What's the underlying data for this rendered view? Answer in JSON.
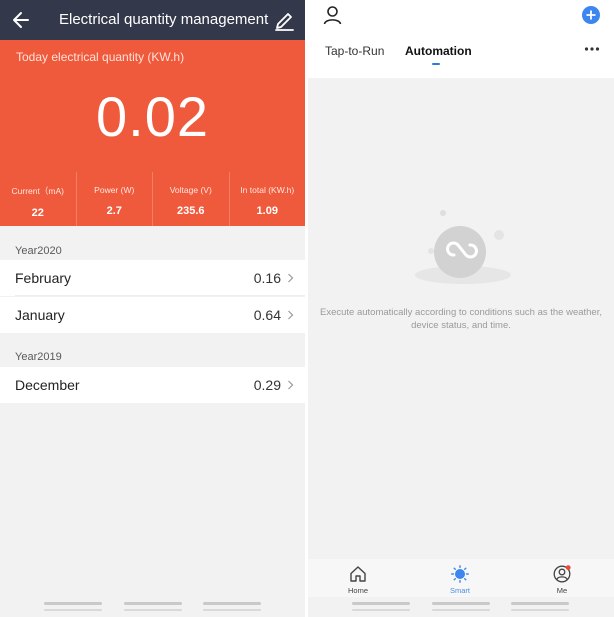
{
  "left": {
    "header": {
      "title": "Electrical quantity management",
      "back_icon": "arrow-left-icon",
      "edit_icon": "pencil-icon"
    },
    "today": {
      "label": "Today electrical quantity (KW.h)",
      "value": "0.02"
    },
    "stats": [
      {
        "label": "Current（mA)",
        "value": "22"
      },
      {
        "label": "Power (W)",
        "value": "2.7"
      },
      {
        "label": "Voltage (V)",
        "value": "235.6"
      },
      {
        "label": "In total (KW.h)",
        "value": "1.09"
      }
    ],
    "years": [
      {
        "year": "Year2020",
        "months": [
          {
            "month": "February",
            "value": "0.16"
          },
          {
            "month": "January",
            "value": "0.64"
          }
        ]
      },
      {
        "year": "Year2019",
        "months": [
          {
            "month": "December",
            "value": "0.29"
          }
        ]
      }
    ]
  },
  "right": {
    "tabs": [
      {
        "label": "Tap-to-Run",
        "active": false
      },
      {
        "label": "Automation",
        "active": true
      }
    ],
    "empty_message": "Execute automatically according to conditions such as the weather, device status, and time.",
    "bottom_tabs": [
      {
        "label": "Home",
        "icon": "home-icon",
        "active": false
      },
      {
        "label": "Smart",
        "icon": "sun-icon",
        "active": true
      },
      {
        "label": "Me",
        "icon": "profile-icon",
        "active": false
      }
    ]
  },
  "colors": {
    "header_bg": "#33384a",
    "accent_orange": "#f05a3c",
    "accent_blue": "#2a7be4",
    "badge_red": "#e8493c"
  }
}
